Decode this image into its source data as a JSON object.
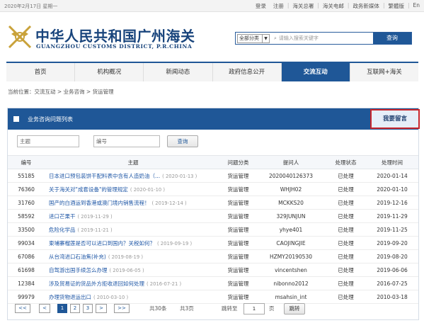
{
  "topbar": {
    "date": "2020年2月17日 星期一",
    "links": [
      "登录",
      "注册",
      "海关总署",
      "海关电邮",
      "政务新媒体",
      "繁體版",
      "En"
    ]
  },
  "header": {
    "title_cn": "中华人民共和国广州海关",
    "title_en": "GUANGZHOU CUSTOMS DISTRICT, P.R.CHINA"
  },
  "search": {
    "category": "全部分类",
    "placeholder": "请输入搜索关键字",
    "button": "查询"
  },
  "nav": {
    "items": [
      "首页",
      "机构概况",
      "新闻动态",
      "政府信息公开",
      "交流互动",
      "互联网+海关"
    ],
    "active_index": 4
  },
  "breadcrumb": "当前位置：交流互动 > 业务咨询 > 货运管理",
  "panel": {
    "title": "业务咨询问题列表",
    "leave_message": "我要留言"
  },
  "filter": {
    "subject_placeholder": "主题",
    "id_placeholder": "编号",
    "button": "查询"
  },
  "table": {
    "headers": [
      "编号",
      "主题",
      "问题分类",
      "提问人",
      "处理状态",
      "处理时间"
    ],
    "rows": [
      {
        "id": "55185",
        "subject": "日本进口预包装饼干配料表中含有人造奶油（...",
        "sdate": "( 2020-01-13 )",
        "category": "货运管理",
        "user": "2020040126373",
        "status": "已处理",
        "time": "2020-01-14"
      },
      {
        "id": "76360",
        "subject": "关于海关对\"成套设备\"的管理规定",
        "sdate": "( 2020-01-10 )",
        "category": "货运管理",
        "user": "WHJH02",
        "status": "已处理",
        "time": "2020-01-10"
      },
      {
        "id": "31760",
        "subject": "国产的白酒运到香港或澳门境内销售流程！",
        "sdate": "( 2019-12-14 )",
        "category": "货运管理",
        "user": "MCKKS20",
        "status": "已处理",
        "time": "2019-12-16"
      },
      {
        "id": "58592",
        "subject": "进口芒果干",
        "sdate": "( 2019-11-29 )",
        "category": "货运管理",
        "user": "329JUNJUN",
        "status": "已处理",
        "time": "2019-11-29"
      },
      {
        "id": "33500",
        "subject": "危险化学品",
        "sdate": "( 2019-11-21 )",
        "category": "货运管理",
        "user": "yhye401",
        "status": "已处理",
        "time": "2019-11-25"
      },
      {
        "id": "99034",
        "subject": "柬埔寨榴莲是否可以进口到国内？关税如何？",
        "sdate": "( 2019-09-19 )",
        "category": "货运管理",
        "user": "CAOJINGJIE",
        "status": "已处理",
        "time": "2019-09-20"
      },
      {
        "id": "67086",
        "subject": "从台湾进口石油焦(补充)",
        "sdate": "( 2019-08-19 )",
        "category": "货运管理",
        "user": "HZMY20190530",
        "status": "已处理",
        "time": "2019-08-20"
      },
      {
        "id": "61698",
        "subject": "自驾游出国手续怎么办理",
        "sdate": "( 2019-06-05 )",
        "category": "货运管理",
        "user": "vincentshen",
        "status": "已处理",
        "time": "2019-06-06"
      },
      {
        "id": "12384",
        "subject": "涉及贸易证的货品外方拒收退回如何处理",
        "sdate": "( 2016-07-21 )",
        "category": "货运管理",
        "user": "nibonno2012",
        "status": "已处理",
        "time": "2016-07-25"
      },
      {
        "id": "99979",
        "subject": "办理货物退运出口",
        "sdate": "( 2010-03-10 )",
        "category": "货运管理",
        "user": "msahsin_int",
        "status": "已处理",
        "time": "2010-03-18"
      }
    ]
  },
  "pager": {
    "first": "<<",
    "prev": "<",
    "pages": [
      "1",
      "2",
      "3"
    ],
    "current": "1",
    "next": ">",
    "last": ">>",
    "total_items": "共30条",
    "total_pages": "共3页",
    "jump_label": "跳转至",
    "jump_value": "1",
    "page_unit": "页",
    "jump_button": "跳转"
  },
  "colors": {
    "brand_blue": "#1f5797",
    "highlight_red": "#c9262c",
    "link_blue": "#1f57a6"
  }
}
